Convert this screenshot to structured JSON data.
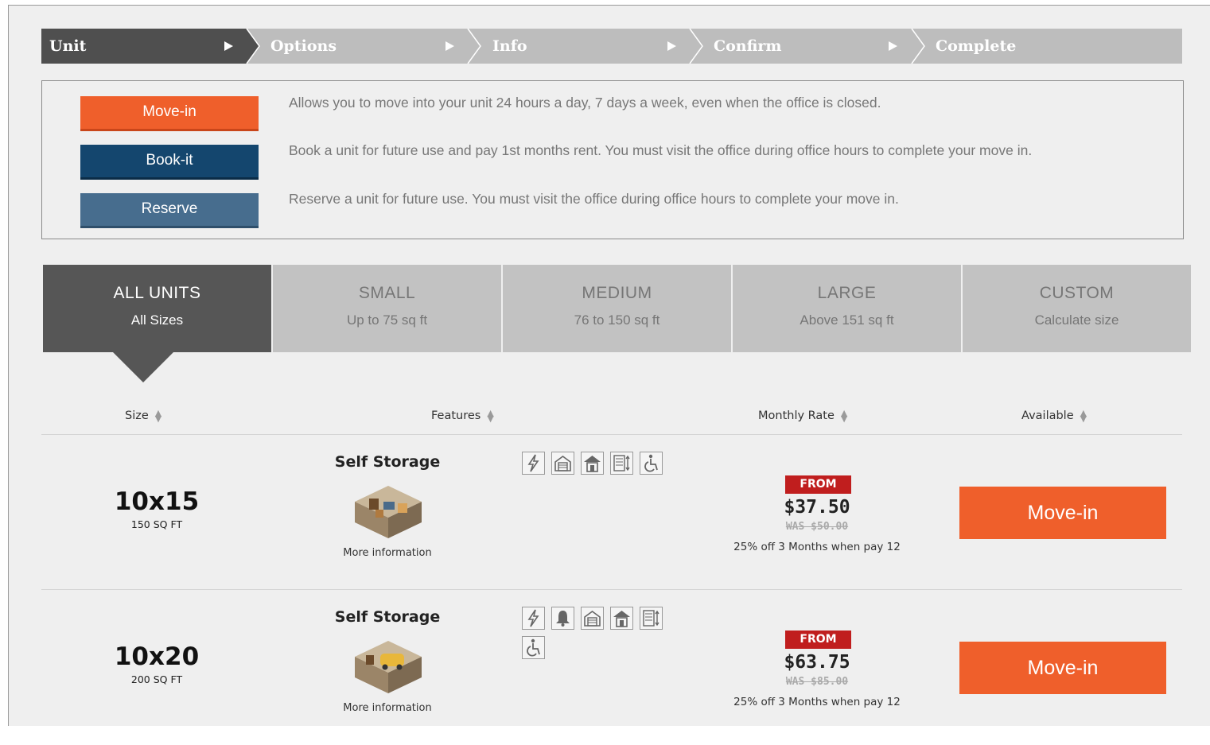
{
  "stepper": {
    "steps": [
      {
        "label": "Unit",
        "active": true
      },
      {
        "label": "Options",
        "active": false
      },
      {
        "label": "Info",
        "active": false
      },
      {
        "label": "Confirm",
        "active": false
      },
      {
        "label": "Complete",
        "active": false
      }
    ]
  },
  "options": [
    {
      "label": "Move-in",
      "color": "#ef5f2b",
      "description": "Allows you to move into your unit 24 hours a day, 7 days a week, even when the office is closed."
    },
    {
      "label": "Book-it",
      "color": "#14466e",
      "description": "Book a unit for future use and pay 1st months rent. You must visit the office during office hours to complete your move in."
    },
    {
      "label": "Reserve",
      "color": "#476d8e",
      "description": "Reserve a unit for future use. You must visit the office during office hours to complete your move in."
    }
  ],
  "size_tabs": [
    {
      "title": "ALL UNITS",
      "subtitle": "All Sizes",
      "active": true
    },
    {
      "title": "SMALL",
      "subtitle": "Up to 75 sq ft",
      "active": false
    },
    {
      "title": "MEDIUM",
      "subtitle": "76 to 150 sq ft",
      "active": false
    },
    {
      "title": "LARGE",
      "subtitle": "Above 151 sq ft",
      "active": false
    },
    {
      "title": "CUSTOM",
      "subtitle": "Calculate size",
      "active": false
    }
  ],
  "columns": {
    "size": "Size",
    "features": "Features",
    "rate": "Monthly Rate",
    "available": "Available"
  },
  "units": [
    {
      "size": "10x15",
      "sqft": "150 SQ FT",
      "type": "Self Storage",
      "more_info": "More information",
      "features": [
        "power-icon",
        "drive-up-icon",
        "indoor-icon",
        "climate-control-icon",
        "accessible-icon"
      ],
      "badge": "FROM",
      "price": "$37.50",
      "was": "WAS $50.00",
      "promo": "25% off 3 Months when pay 12",
      "action": "Move-in"
    },
    {
      "size": "10x20",
      "sqft": "200 SQ FT",
      "type": "Self Storage",
      "more_info": "More information",
      "features": [
        "power-icon",
        "alarm-icon",
        "drive-up-icon",
        "indoor-icon",
        "climate-control-icon",
        "accessible-icon"
      ],
      "badge": "FROM",
      "price": "$63.75",
      "was": "WAS $85.00",
      "promo": "25% off 3 Months when pay 12",
      "action": "Move-in"
    }
  ],
  "colors": {
    "accent": "#ef5f2b",
    "active_tab": "#565656",
    "inactive_tab": "#c2c2c2",
    "badge": "#c01e1e"
  }
}
